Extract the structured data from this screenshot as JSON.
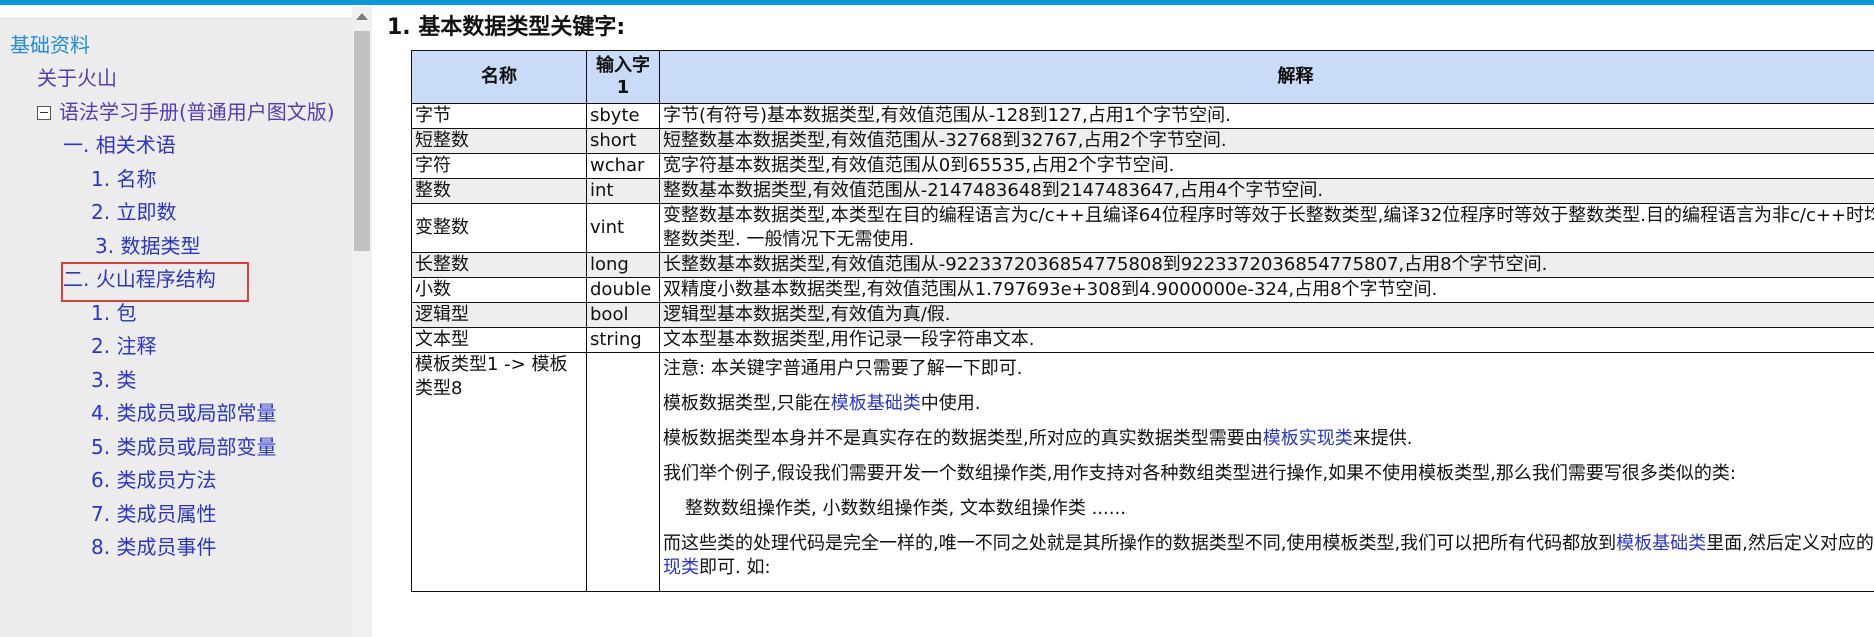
{
  "sidebar": {
    "root_label": "基础资料",
    "about_label": "关于火山",
    "manual_label": "语法学习手册(普通用户图文版)",
    "section1_label": "一. 相关术语",
    "s1_items": [
      "1. 名称",
      "2. 立即数",
      "3. 数据类型"
    ],
    "section2_label": "二. 火山程序结构",
    "s2_items": [
      "1. 包",
      "2. 注释",
      "3. 类",
      "4. 类成员或局部常量",
      "5. 类成员或局部变量",
      "6. 类成员方法",
      "7. 类成员属性",
      "8. 类成员事件"
    ]
  },
  "content": {
    "heading": "1. 基本数据类型关键字:",
    "table": {
      "headers": {
        "name": "名称",
        "keyword": "输入字1",
        "explain": "解释"
      },
      "rows": [
        {
          "name": "字节",
          "keyword": "sbyte",
          "explain": "字节(有符号)基本数据类型,有效值范围从-128到127,占用1个字节空间."
        },
        {
          "name": "短整数",
          "keyword": "short",
          "explain": "短整数基本数据类型,有效值范围从-32768到32767,占用2个字节空间."
        },
        {
          "name": "字符",
          "keyword": "wchar",
          "explain": "宽字符基本数据类型,有效值范围从0到65535,占用2个字节空间."
        },
        {
          "name": "整数",
          "keyword": "int",
          "explain": "整数基本数据类型,有效值范围从-2147483648到2147483647,占用4个字节空间."
        },
        {
          "name": "变整数",
          "keyword": "vint",
          "explain": "变整数基本数据类型,本类型在目的编程语言为c/c++且编译64位程序时等效于长整数类型,编译32位程序时等效于整数类型.目的编程语言为非c/c++时均等于整数类型. 一般情况下无需使用."
        },
        {
          "name": "长整数",
          "keyword": "long",
          "explain": "长整数基本数据类型,有效值范围从-9223372036854775808到9223372036854775807,占用8个字节空间."
        },
        {
          "name": "小数",
          "keyword": "double",
          "explain": "双精度小数基本数据类型,有效值范围从1.797693e+308到4.9000000e-324,占用8个字节空间."
        },
        {
          "name": "逻辑型",
          "keyword": "bool",
          "explain": "逻辑型基本数据类型,有效值为真/假."
        },
        {
          "name": "文本型",
          "keyword": "string",
          "explain": "文本型基本数据类型,用作记录一段字符串文本."
        }
      ],
      "template_row": {
        "name": "模板类型1 -> 模板类型8",
        "keyword": "",
        "p1": "注意: 本关键字普通用户只需要了解一下即可.",
        "p2_a": "模板数据类型,只能在",
        "p2_link": "模板基础类",
        "p2_b": "中使用.",
        "p3_a": "模板数据类型本身并不是真实存在的数据类型,所对应的真实数据类型需要由",
        "p3_link": "模板实现类",
        "p3_b": "来提供.",
        "p4": "我们举个例子,假设我们需要开发一个数组操作类,用作支持对各种数组类型进行操作,如果不使用模板类型,那么我们需要写很多类似的类:",
        "p5": "整数数组操作类, 小数数组操作类, 文本数组操作类 ......",
        "p6_a": "而这些类的处理代码是完全一样的,唯一不同之处就是其所操作的数据类型不同,使用模板类型,我们可以把所有代码都放到",
        "p6_link1": "模板基础类",
        "p6_b": "里面,然后定义对应的",
        "p6_link2": "模板实现类",
        "p6_c": "即可. 如:"
      }
    }
  }
}
